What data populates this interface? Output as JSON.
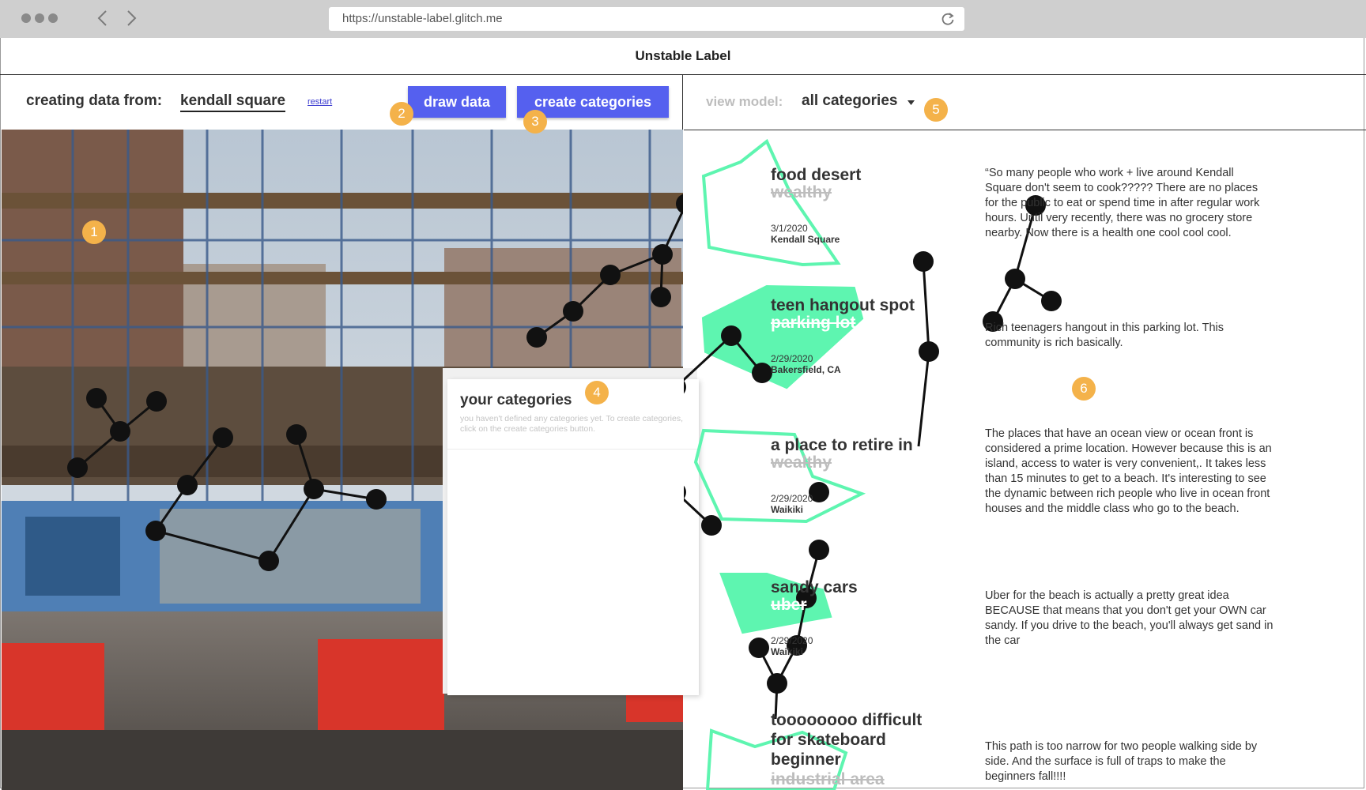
{
  "browser": {
    "url": "https://unstable-label.glitch.me",
    "back_icon": "chevron-left",
    "forward_icon": "chevron-right",
    "reload_icon": "reload"
  },
  "app": {
    "title": "Unstable Label"
  },
  "left": {
    "source_label": "creating data from:",
    "source_value": "kendall square",
    "restart_link": "restart",
    "draw_button": "draw data",
    "categories_button": "create categories",
    "button_color": "#5560ef"
  },
  "categories_panel": {
    "title": "your categories",
    "empty_message": "you haven't defined any categories yet. To create categories, click on the create categories button."
  },
  "right": {
    "view_label": "view model:",
    "view_value": "all categories",
    "dropdown_icon": "caret-down",
    "accent_color": "#5ef5b0",
    "entries": [
      {
        "title": "food desert",
        "struck": "wealthy",
        "date": "3/1/2020",
        "place": "Kendall Square",
        "text": "“So many people who work  + live around Kendall Square don't seem to cook????? There are no places for the public to eat or spend time in after regular work hours. Until very recently, there was no grocery store nearby. Now there is a health one cool cool cool."
      },
      {
        "title": "teen hangout spot",
        "struck": "parking lot",
        "date": "2/29/2020",
        "place": "Bakersfield, CA",
        "text": "Rich teenagers hangout in this parking lot. This community is rich basically."
      },
      {
        "title": "a place to retire in",
        "struck": "wealthy",
        "date": "2/29/2020",
        "place": "Waikiki",
        "text": "The places that have an ocean view or ocean front is considered a prime location. However because this is an island, access to water is very convenient,. It takes less than 15 minutes to get to a beach. It's interesting to see the dynamic between rich people who live in ocean front houses and the middle class who go to the beach."
      },
      {
        "title": "sandy cars",
        "struck": "uber",
        "date": "2/29/2020",
        "place": "Waikiki",
        "text": "Uber for the beach is actually a pretty great idea BECAUSE that means that you don't get your OWN car sandy. If you drive to the beach, you'll always get sand in the car"
      },
      {
        "title_lines": [
          "toooooooo difficult",
          "for skateboard",
          "beginner"
        ],
        "struck": "industrial area",
        "text": "This path is too narrow for two people walking side by side. And the surface is full of traps to make the beginners fall!!!!"
      }
    ]
  },
  "annotations": [
    "1",
    "2",
    "3",
    "4",
    "5",
    "6"
  ],
  "badge_color": "#f4b24a"
}
